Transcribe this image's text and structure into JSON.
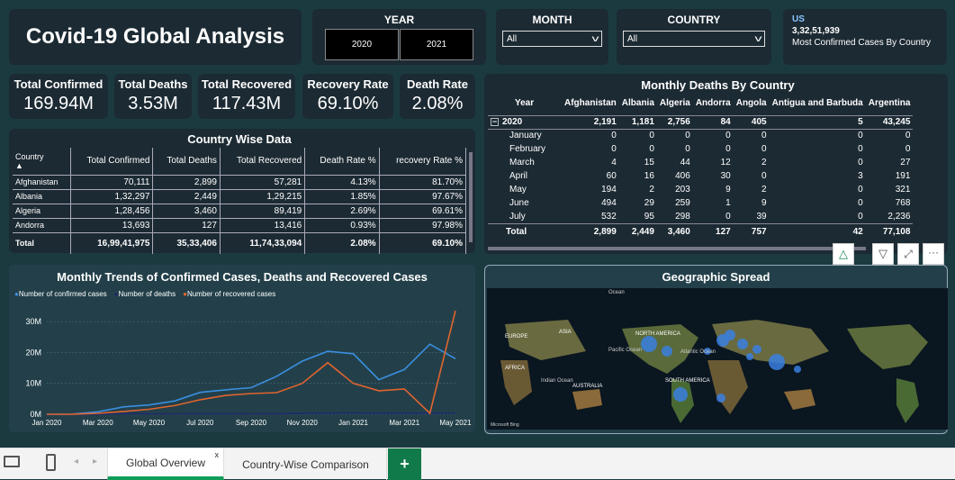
{
  "title": "Covid-19 Global Analysis",
  "year": {
    "label": "YEAR",
    "options": [
      "2020",
      "2021"
    ]
  },
  "month": {
    "label": "MONTH",
    "value": "All"
  },
  "country": {
    "label": "COUNTRY",
    "value": "All"
  },
  "top_card": {
    "country": "US",
    "value": "3,32,51,939",
    "caption": "Most Confirmed Cases By Country"
  },
  "kpis": [
    {
      "label": "Total Confirmed",
      "value": "169.94M"
    },
    {
      "label": "Total Deaths",
      "value": "3.53M"
    },
    {
      "label": "Total Recovered",
      "value": "117.43M"
    },
    {
      "label": "Recovery Rate",
      "value": "69.10%"
    },
    {
      "label": "Death Rate",
      "value": "2.08%"
    }
  ],
  "country_wise": {
    "title": "Country Wise Data",
    "headers": [
      "Country",
      "Total Confirmed",
      "Total Deaths",
      "Total Recovered",
      "Death Rate %",
      "recovery Rate %"
    ],
    "rows": [
      [
        "Afghanistan",
        "70,111",
        "2,899",
        "57,281",
        "4.13%",
        "81.70%"
      ],
      [
        "Albania",
        "1,32,297",
        "2,449",
        "1,29,215",
        "1.85%",
        "97.67%"
      ],
      [
        "Algeria",
        "1,28,456",
        "3,460",
        "89,419",
        "2.69%",
        "69.61%"
      ],
      [
        "Andorra",
        "13,693",
        "127",
        "13,416",
        "0.93%",
        "97.98%"
      ]
    ],
    "total": [
      "Total",
      "16,99,41,975",
      "35,33,406",
      "11,74,33,094",
      "2.08%",
      "69.10%"
    ]
  },
  "monthly_deaths": {
    "title": "Monthly Deaths By Country",
    "headers": [
      "Year",
      "Afghanistan",
      "Albania",
      "Algeria",
      "Andorra",
      "Angola",
      "Antigua and Barbuda",
      "Argentina"
    ],
    "year_row": [
      "2020",
      "2,191",
      "1,181",
      "2,756",
      "84",
      "405",
      "5",
      "43,245"
    ],
    "rows": [
      [
        "January",
        "0",
        "0",
        "0",
        "0",
        "0",
        "0",
        "0"
      ],
      [
        "February",
        "0",
        "0",
        "0",
        "0",
        "0",
        "0",
        "0"
      ],
      [
        "March",
        "4",
        "15",
        "44",
        "12",
        "2",
        "0",
        "27"
      ],
      [
        "April",
        "60",
        "16",
        "406",
        "30",
        "0",
        "3",
        "191"
      ],
      [
        "May",
        "194",
        "2",
        "203",
        "9",
        "2",
        "0",
        "321"
      ],
      [
        "June",
        "494",
        "29",
        "259",
        "1",
        "9",
        "0",
        "768"
      ],
      [
        "July",
        "532",
        "95",
        "298",
        "0",
        "39",
        "0",
        "2,236"
      ]
    ],
    "total": [
      "Total",
      "2,899",
      "2,449",
      "3,460",
      "127",
      "757",
      "42",
      "77,108"
    ]
  },
  "chart_data": {
    "type": "line",
    "title": "Monthly Trends of Confirmed Cases, Deaths and Recovered Cases",
    "x": [
      "Jan 2020",
      "Feb 2020",
      "Mar 2020",
      "Apr 2020",
      "May 2020",
      "Jun 2020",
      "Jul 2020",
      "Aug 2020",
      "Sep 2020",
      "Oct 2020",
      "Nov 2020",
      "Dec 2020",
      "Jan 2021",
      "Feb 2021",
      "Mar 2021",
      "Apr 2021",
      "May 2021"
    ],
    "xticks": [
      "Jan 2020",
      "Mar 2020",
      "May 2020",
      "Jul 2020",
      "Sep 2020",
      "Nov 2020",
      "Jan 2021",
      "Mar 2021",
      "May 2021"
    ],
    "yticks": [
      "0M",
      "10M",
      "20M",
      "30M"
    ],
    "ylim": [
      0,
      35
    ],
    "series": [
      {
        "name": "Number of confirmed cases",
        "color": "#3a8fe0",
        "values": [
          0.01,
          0.07,
          0.8,
          2.4,
          3.0,
          4.3,
          7.1,
          7.9,
          8.6,
          12.3,
          17.2,
          20.4,
          19.6,
          11.2,
          14.5,
          22.7,
          18.0
        ]
      },
      {
        "name": "Number of deaths",
        "color": "#1f2a6a",
        "values": [
          0,
          0,
          0.04,
          0.2,
          0.14,
          0.14,
          0.17,
          0.18,
          0.16,
          0.17,
          0.27,
          0.36,
          0.39,
          0.32,
          0.29,
          0.38,
          0.3
        ]
      },
      {
        "name": "Number of recovered cases",
        "color": "#e0642e",
        "values": [
          0,
          0.02,
          0.3,
          0.9,
          1.6,
          2.8,
          4.7,
          6.1,
          6.7,
          7.0,
          10.0,
          16.7,
          10.0,
          7.6,
          8.2,
          0.3,
          33.5
        ]
      }
    ]
  },
  "map": {
    "title": "Geographic Spread",
    "labels": [
      "Ocean",
      "ASIA",
      "NORTH AMERICA",
      "EUROPE",
      "Atlantic Ocean",
      "Pacific Ocean",
      "AFRICA",
      "Indian Ocean",
      "AUSTRALIA",
      "SOUTH AMERICA"
    ],
    "credit": "Microsoft Bing"
  },
  "tabs": [
    {
      "label": "Global Overview",
      "active": true
    },
    {
      "label": "Country-Wise Comparison",
      "active": false
    }
  ]
}
